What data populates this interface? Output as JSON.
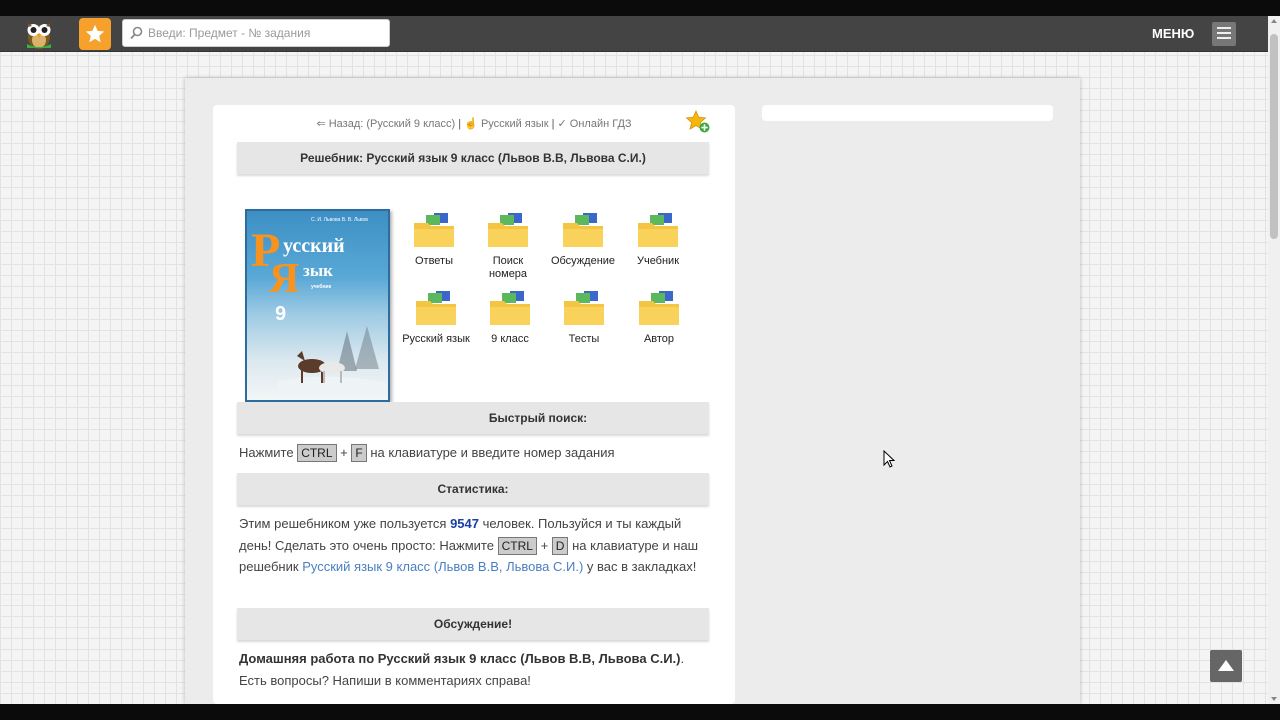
{
  "navbar": {
    "search_placeholder": "Введи: Предмет - № задания",
    "menu_label": "МЕНЮ"
  },
  "breadcrumb": {
    "back": "⇐ Назад: (Русский 9 класс)",
    "subject": "☝ Русский язык",
    "online": "✓ Онлайн ГДЗ"
  },
  "main": {
    "title": "Решебник: Русский язык 9 класс (Львов В.В, Львова С.И.)",
    "folders": [
      {
        "label": "Ответы"
      },
      {
        "label": "Поиск номера"
      },
      {
        "label": "Обсуждение"
      },
      {
        "label": "Учебник"
      },
      {
        "label": "Русский язык"
      },
      {
        "label": "9 класс"
      },
      {
        "label": "Тесты"
      },
      {
        "label": "Автор"
      }
    ],
    "cover": {
      "title_line1": "усский",
      "title_line2": "зык",
      "letter_r": "Р",
      "letter_ya": "Я",
      "grade": "9",
      "subtitle": "учебник",
      "authors": "С. И. Львова  В. В. Львов"
    },
    "quick_search": {
      "header": "Быстрый поиск:",
      "text_before": "Нажмите",
      "key1": "CTRL",
      "plus": "+",
      "key2": "F",
      "text_after": "на клавиатуре и введите номер задания"
    },
    "stats": {
      "header": "Статистика:",
      "text1": "Этим решебником уже пользуется",
      "count": "9547",
      "text2": "человек. Пользуйся и ты каждый день! Сделать это очень просто: Нажмите",
      "key1": "CTRL",
      "plus": "+",
      "key2": "D",
      "text3": "на клавиатуре и наш решебник",
      "link": "Русский язык 9 класс (Львов В.В, Львова С.И.)",
      "text4": "у вас в закладках!"
    },
    "discussion": {
      "header": "Обсуждение!",
      "bold_text": "Домашняя работа по Русский язык 9 класс (Львов В.В, Львова С.И.)",
      "dot": ".",
      "text": "Есть вопросы? Напиши в комментариях справа!"
    }
  },
  "colors": {
    "navbar": "#444444",
    "star_button": "#f6a12b",
    "link": "#4a7fc1",
    "count": "#1a3fa8"
  }
}
